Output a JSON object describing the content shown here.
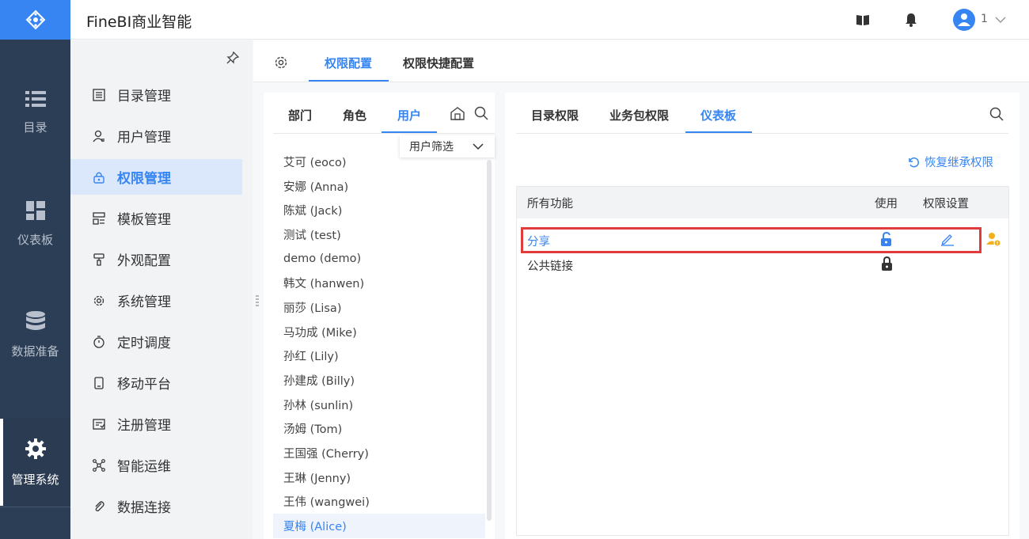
{
  "app": {
    "title": "FineBI商业智能",
    "user": "1"
  },
  "rail": {
    "items": [
      {
        "label": "目录",
        "icon": "list-icon"
      },
      {
        "label": "仪表板",
        "icon": "dashboard-icon"
      },
      {
        "label": "数据准备",
        "icon": "database-icon"
      },
      {
        "label": "管理系统",
        "icon": "gear-icon"
      }
    ]
  },
  "menu": {
    "items": [
      {
        "label": "目录管理",
        "icon": "catalog-icon"
      },
      {
        "label": "用户管理",
        "icon": "user-icon"
      },
      {
        "label": "权限管理",
        "icon": "lock-icon"
      },
      {
        "label": "模板管理",
        "icon": "template-icon"
      },
      {
        "label": "外观配置",
        "icon": "brush-icon"
      },
      {
        "label": "系统管理",
        "icon": "gear-icon"
      },
      {
        "label": "定时调度",
        "icon": "timer-icon"
      },
      {
        "label": "移动平台",
        "icon": "mobile-icon"
      },
      {
        "label": "注册管理",
        "icon": "register-icon"
      },
      {
        "label": "智能运维",
        "icon": "network-icon"
      },
      {
        "label": "数据连接",
        "icon": "link-icon"
      }
    ]
  },
  "top_tabs": [
    "权限配置",
    "权限快捷配置"
  ],
  "mid": {
    "tabs": [
      "部门",
      "角色",
      "用户"
    ],
    "filter_label": "用户筛选",
    "users": [
      "艾可 (eoco)",
      "安娜 (Anna)",
      "陈斌 (Jack)",
      "测试 (test)",
      "demo (demo)",
      "韩文 (hanwen)",
      "丽莎 (Lisa)",
      "马功成 (Mike)",
      "孙红 (Lily)",
      "孙建成 (Billy)",
      "孙林 (sunlin)",
      "汤姆 (Tom)",
      "王国强 (Cherry)",
      "王琳 (Jenny)",
      "王伟 (wangwei)",
      "夏梅 (Alice)"
    ]
  },
  "right": {
    "tabs": [
      "目录权限",
      "业务包权限",
      "仪表板"
    ],
    "restore_label": "恢复继承权限",
    "columns": {
      "all": "所有功能",
      "use": "使用",
      "setting": "权限设置"
    },
    "rows": [
      {
        "label": "分享"
      },
      {
        "label": "公共链接"
      }
    ]
  },
  "colors": {
    "accent": "#3685f2",
    "rail_bg": "#2c3e55",
    "highlight": "#e03c3c"
  }
}
